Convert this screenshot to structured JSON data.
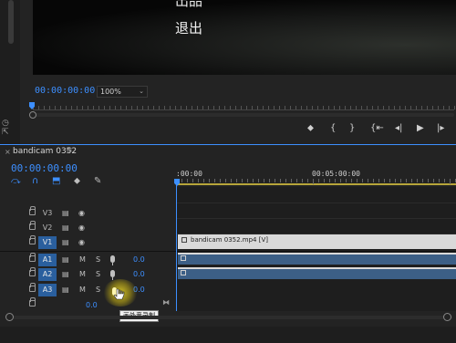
{
  "monitor": {
    "subtitle_top": "出品",
    "subtitle": "退出",
    "timecode": "00:00:00:00",
    "zoom": "100%"
  },
  "controls": {
    "marker": "⬥",
    "in_mark": "{",
    "out_mark": "}",
    "go_in": "{⇤",
    "step_back": "◂|",
    "play": "▶",
    "step_fwd": "|▸",
    "go_out": "⇥}"
  },
  "timeline": {
    "close": "×",
    "tab_title": "bandicam 0352",
    "menu": "≡",
    "timecode": "00:00:00:00",
    "time_start": ":00:00",
    "time_mid": "00:05:00:00",
    "video_tracks": [
      {
        "name": "V3",
        "active": false
      },
      {
        "name": "V2",
        "active": false
      },
      {
        "name": "V1",
        "active": true
      }
    ],
    "audio_tracks": [
      {
        "name": "A1",
        "m": "M",
        "s": "S",
        "volume": "0.0"
      },
      {
        "name": "A2",
        "m": "M",
        "s": "S",
        "volume": "0.0"
      },
      {
        "name": "A3",
        "m": "M",
        "s": "S",
        "volume": "0.0"
      }
    ],
    "mix_volume": "0.0",
    "video_clip_label": "bandicam 0352.mp4 [V]",
    "tooltip": "画外音录制"
  },
  "colors": {
    "accent": "#3d8fff",
    "track_active": "#2a5f9e",
    "audio_clip": "#3c5f86",
    "highlight": "#f0dc28"
  }
}
